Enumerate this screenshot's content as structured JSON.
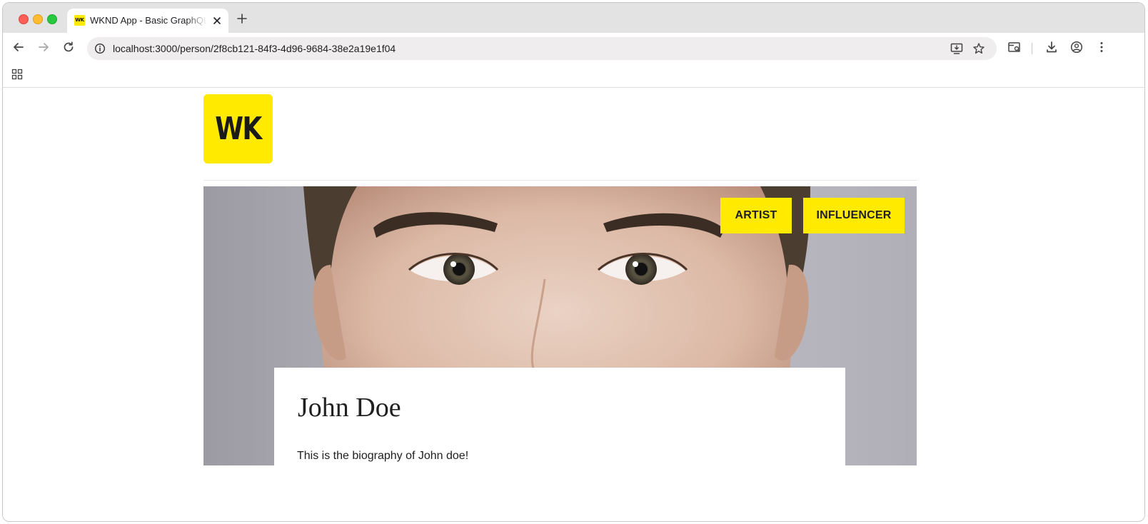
{
  "browser": {
    "tab": {
      "favicon_text": "WK",
      "title": "WKND App - Basic GraphQL Tutorial"
    },
    "address_bar": {
      "url": "localhost:3000/person/2f8cb121-84f3-4d96-9684-38e2a19e1f04"
    },
    "icons": {
      "back": "arrow-left-icon",
      "forward": "arrow-right-icon",
      "reload": "reload-icon",
      "site_info": "info-icon",
      "install": "install-app-icon",
      "bookmark": "star-icon",
      "search_tabs": "tab-search-icon",
      "downloads": "download-icon",
      "profile": "profile-icon",
      "menu": "kebab-menu-icon",
      "apps": "apps-grid-icon"
    }
  },
  "page": {
    "logo_text": "WK",
    "tags": [
      "ARTIST",
      "INFLUENCER"
    ],
    "person": {
      "name": "John Doe",
      "biography": "This is the biography of John doe!"
    }
  },
  "colors": {
    "brand_yellow": "#ffea00",
    "text": "#202020"
  }
}
